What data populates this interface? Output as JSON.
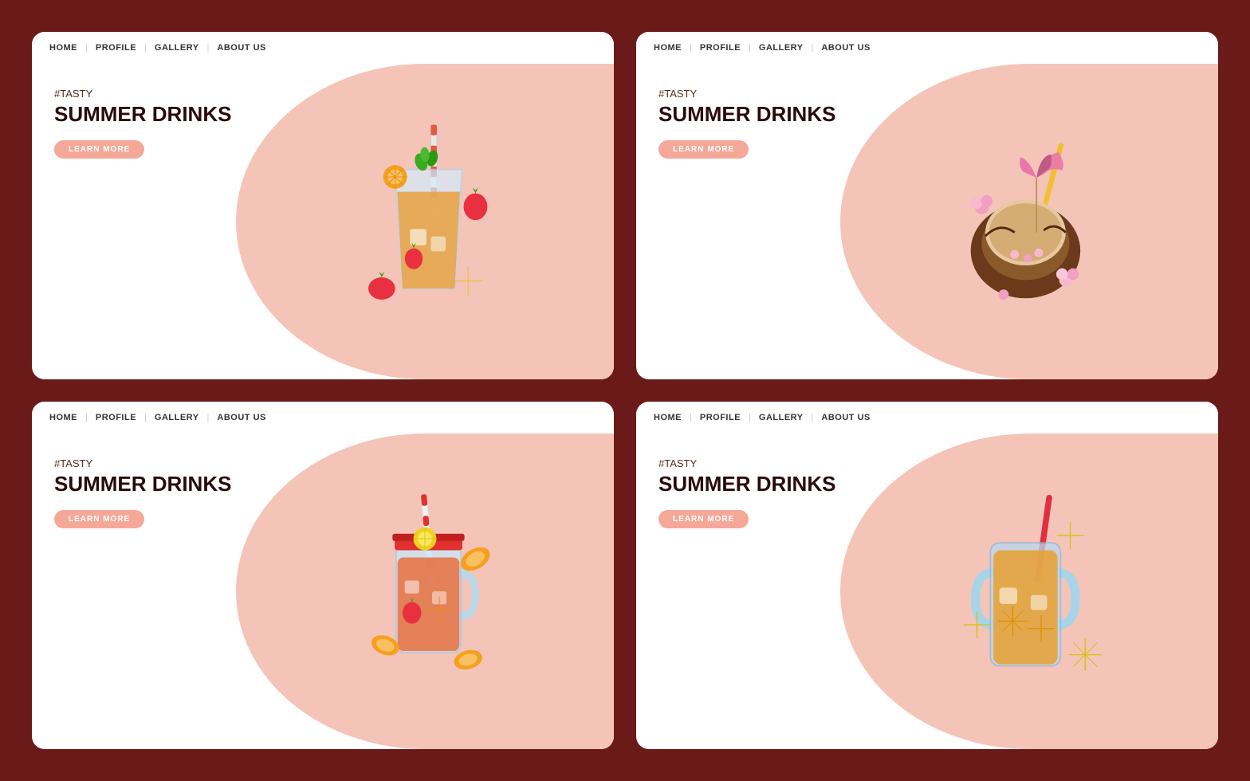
{
  "nav": {
    "home": "HOME",
    "profile": "PROFILE",
    "gallery": "GALLERY",
    "about": "ABOUT US"
  },
  "cards": [
    {
      "id": "card1",
      "hashtag": "#TASTY",
      "title": "SUMMER DRINKS",
      "button": "LEARN MORE",
      "drink": "iced-tea-glass"
    },
    {
      "id": "card2",
      "hashtag": "#TASTY",
      "title": "SUMMER DRINKS",
      "button": "LEARN MORE",
      "drink": "coconut"
    },
    {
      "id": "card3",
      "hashtag": "#TASTY",
      "title": "SUMMER DRINKS",
      "button": "LEARN MORE",
      "drink": "mason-jar-red"
    },
    {
      "id": "card4",
      "hashtag": "#TASTY",
      "title": "SUMMER DRINKS",
      "button": "LEARN MORE",
      "drink": "mason-jar-blue"
    }
  ],
  "colors": {
    "background": "#6B1A1A",
    "card_bg": "#ffffff",
    "blob": "#f5c4b8",
    "title": "#2a0a0a",
    "hashtag": "#5a2a1a",
    "button_bg": "#f5a898"
  }
}
